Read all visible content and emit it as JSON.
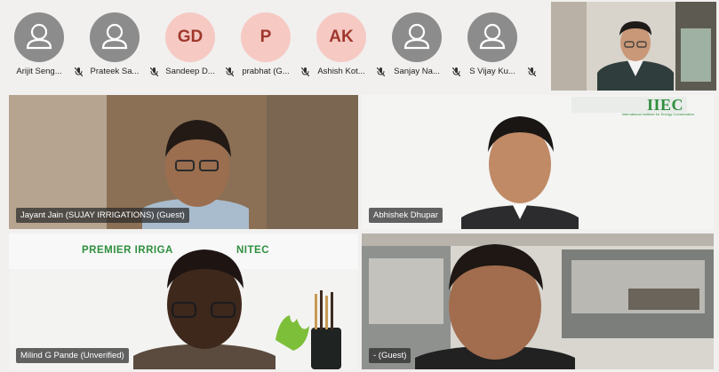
{
  "participants": [
    {
      "name": "Arijit Seng...",
      "avatar": "person-icon",
      "initials": ""
    },
    {
      "name": "Prateek Sa...",
      "avatar": "person-icon",
      "initials": ""
    },
    {
      "name": "Sandeep D...",
      "avatar": "initials",
      "initials": "GD"
    },
    {
      "name": "prabhat (G...",
      "avatar": "initials",
      "initials": "P"
    },
    {
      "name": "Ashish Kot...",
      "avatar": "initials",
      "initials": "AK"
    },
    {
      "name": "Sanjay Na...",
      "avatar": "person-icon",
      "initials": ""
    },
    {
      "name": "S Vijay Ku...",
      "avatar": "person-icon",
      "initials": ""
    }
  ],
  "tiles": {
    "jayant": {
      "name": "Jayant Jain (SUJAY IRRIGATIONS) (Guest)"
    },
    "abhishek": {
      "name": "Abhishek Dhupar",
      "brand": "IIEC",
      "brand_sub": "International Institute for Energy Conservation"
    },
    "milind": {
      "name": "Milind G Pande (Unverified)",
      "brand": "PREMIER IRRIGA",
      "brand2": "NITEC"
    },
    "guest": {
      "name": "- (Guest)"
    }
  },
  "colors": {
    "avatar_grey": "#8c8c8c",
    "avatar_pink": "#f6c9c3",
    "initials_text": "#a0382e",
    "active_outline": "#6c6fc4",
    "brand_green": "#2f8f3e"
  }
}
